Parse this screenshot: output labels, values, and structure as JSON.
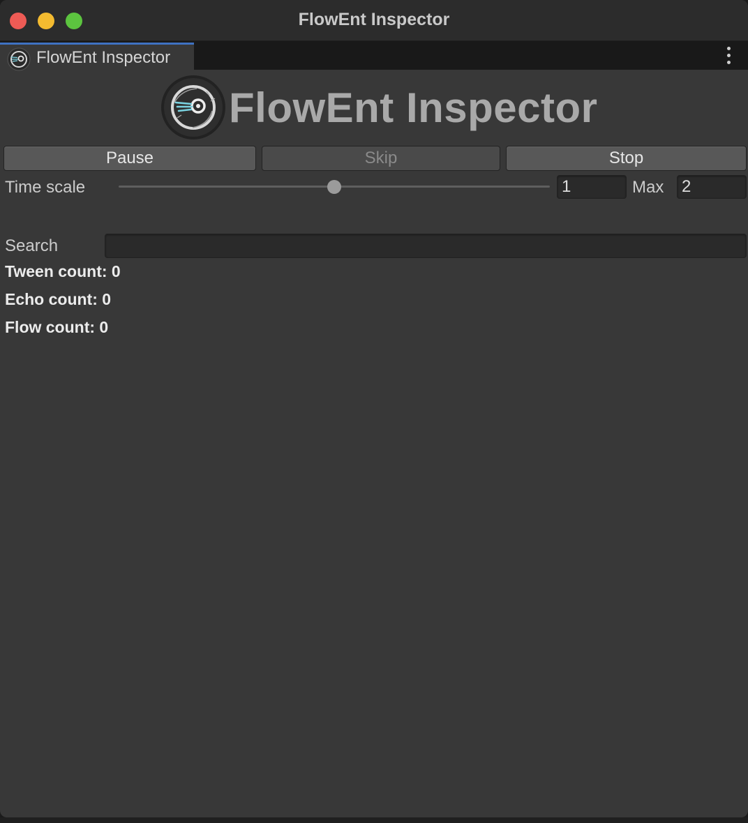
{
  "window": {
    "title": "FlowEnt Inspector"
  },
  "tab": {
    "label": "FlowEnt Inspector",
    "icon": "flowent-logo-icon"
  },
  "header": {
    "title": "FlowEnt Inspector",
    "logo": "flowent-logo-icon"
  },
  "controls": {
    "pause_label": "Pause",
    "skip_label": "Skip",
    "stop_label": "Stop",
    "skip_enabled": false
  },
  "time_scale": {
    "label": "Time scale",
    "value": "1",
    "max_label": "Max",
    "max_value": "2",
    "slider_fraction": 0.5
  },
  "search": {
    "label": "Search",
    "value": ""
  },
  "counts": {
    "tween": "Tween count: 0",
    "echo": "Echo count: 0",
    "flow": "Flow count: 0"
  },
  "colors": {
    "tab_accent": "#3f72c2",
    "close": "#ee5b55",
    "minimize": "#f4bb30",
    "maximize": "#5cc43f"
  }
}
